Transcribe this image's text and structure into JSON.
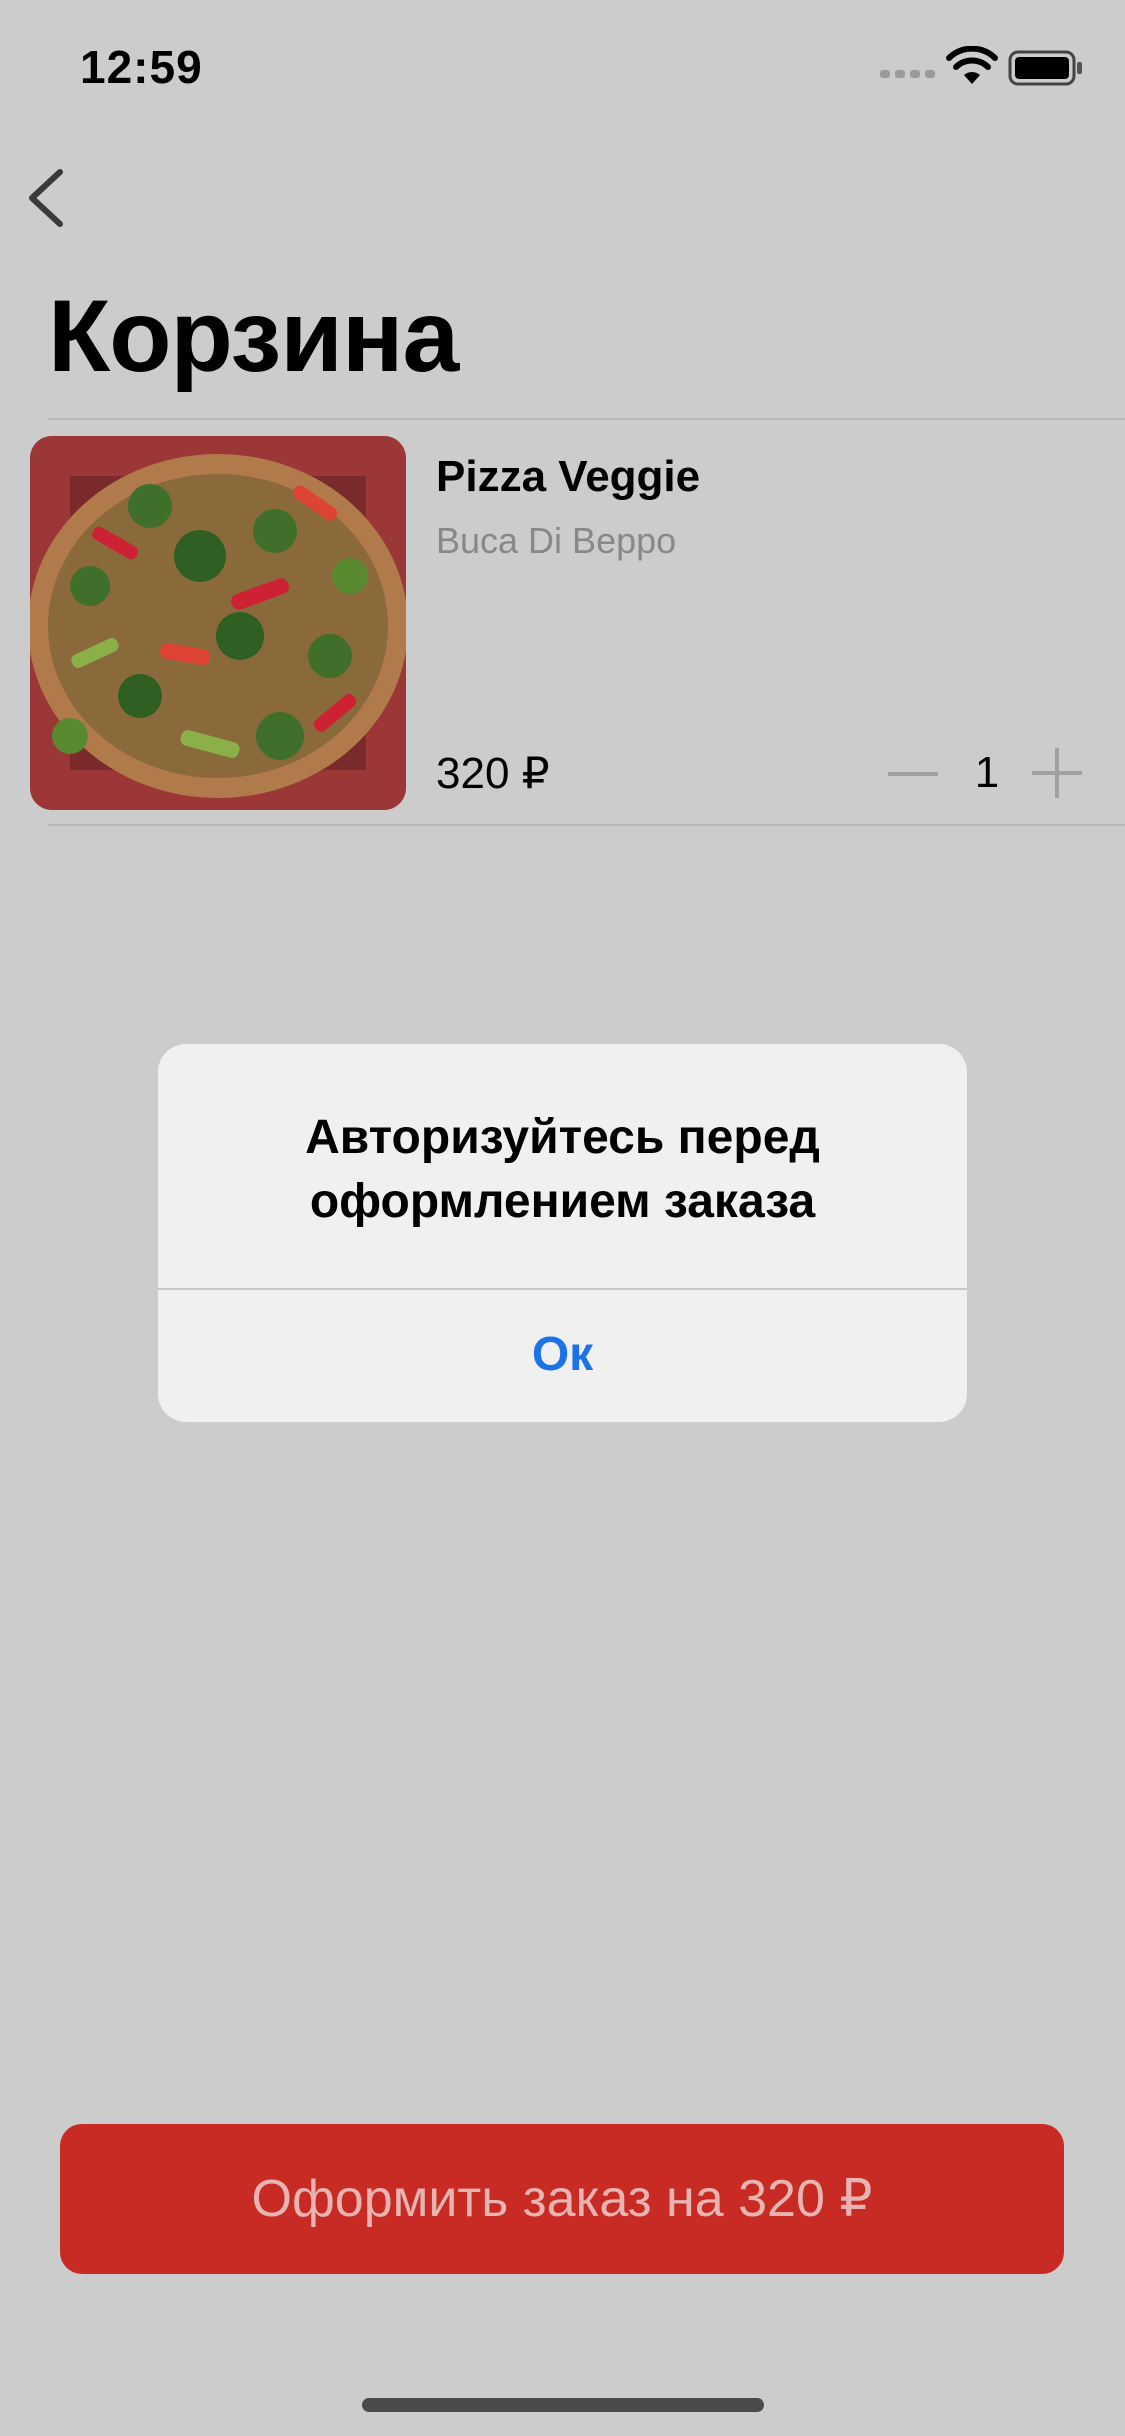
{
  "status_bar": {
    "time": "12:59"
  },
  "page": {
    "title": "Корзина"
  },
  "cart": {
    "items": [
      {
        "name": "Pizza Veggie",
        "restaurant": "Buca Di Beppo",
        "price": "320 ₽",
        "quantity": "1"
      }
    ]
  },
  "alert": {
    "title": "Авторизуйтесь перед оформлением заказа",
    "ok_label": "Ок"
  },
  "checkout": {
    "label": "Оформить заказ на 320 ₽"
  },
  "colors": {
    "background": "#cccccc",
    "checkout_bg": "#c72b24",
    "alert_button": "#1a73e8"
  }
}
